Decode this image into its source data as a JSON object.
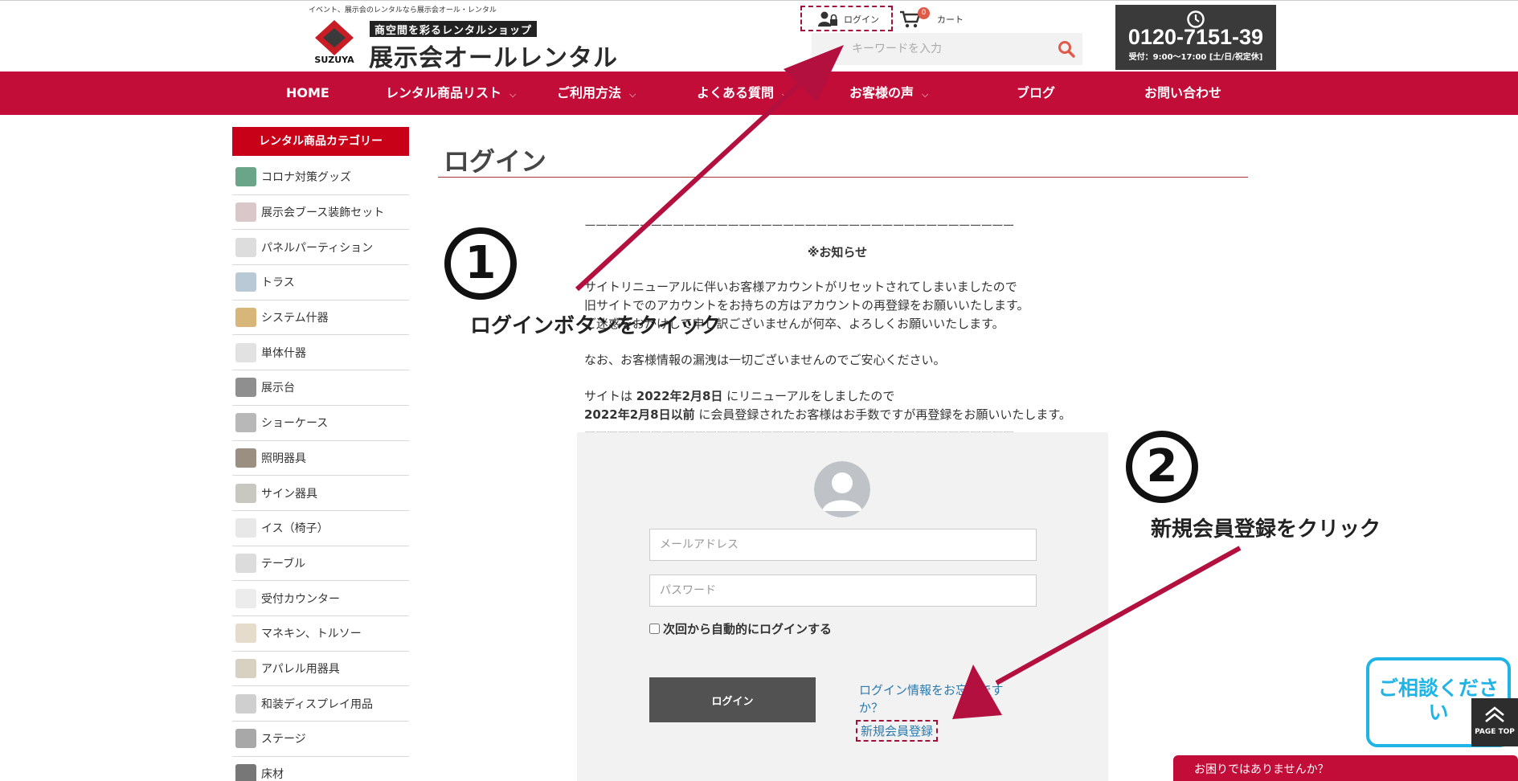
{
  "header": {
    "tagline": "イベント、展示会のレンタルなら展示会オール・レンタル",
    "logo_brand": "SUZUYA",
    "logo_sub": "商空間を彩るレンタルショップ",
    "logo_main": "展示会オールレンタル",
    "login_label": "ログイン",
    "cart_label": "カート",
    "cart_count": "0",
    "search_placeholder": "キーワードを入力",
    "phone_number": "0120-7151-39",
    "phone_hours": "受付：9:00〜17:00 [土/日/祝定休]"
  },
  "nav": [
    {
      "label": "HOME",
      "chevron": ""
    },
    {
      "label": "レンタル商品リスト",
      "chevron": "⌵"
    },
    {
      "label": "ご利用方法",
      "chevron": "⌵"
    },
    {
      "label": "よくある質問",
      "chevron": "⌵"
    },
    {
      "label": "お客様の声",
      "chevron": "⌵"
    },
    {
      "label": "ブログ",
      "chevron": ""
    },
    {
      "label": "お問い合わせ",
      "chevron": ""
    }
  ],
  "sidebar": {
    "title": "レンタル商品カテゴリー",
    "items": [
      {
        "label": "コロナ対策グッズ",
        "color": "#6aa58a"
      },
      {
        "label": "展示会ブース装飾セット",
        "color": "#d9c7c9"
      },
      {
        "label": "パネルパーティション",
        "color": "#dddddd"
      },
      {
        "label": "トラス",
        "color": "#b9c9d6"
      },
      {
        "label": "システム什器",
        "color": "#d8b679"
      },
      {
        "label": "単体什器",
        "color": "#e2e2e2"
      },
      {
        "label": "展示台",
        "color": "#8f8f8f"
      },
      {
        "label": "ショーケース",
        "color": "#b8b8b8"
      },
      {
        "label": "照明器具",
        "color": "#9a8f80"
      },
      {
        "label": "サイン器具",
        "color": "#c8c8c0"
      },
      {
        "label": "イス（椅子）",
        "color": "#e8e8e8"
      },
      {
        "label": "テーブル",
        "color": "#dcdcdc"
      },
      {
        "label": "受付カウンター",
        "color": "#ececec"
      },
      {
        "label": "マネキン、トルソー",
        "color": "#e6dccc"
      },
      {
        "label": "アパレル用器具",
        "color": "#d8d0c0"
      },
      {
        "label": "和装ディスプレイ用品",
        "color": "#cfcfcf"
      },
      {
        "label": "ステージ",
        "color": "#a8a8a8"
      },
      {
        "label": "床材",
        "color": "#777777"
      }
    ]
  },
  "main": {
    "page_title": "ログイン",
    "dashes": "ーーーーーーーーーーーーーーーーーーーーーーーーーーーーーーーーーーーーーーー",
    "notice_title": "※お知らせ",
    "notice_line1": "サイトリニューアルに伴いお客様アカウントがリセットされてしまいましたので",
    "notice_line2": "旧サイトでのアカウントをお持ちの方はアカウントの再登録をお願いいたします。",
    "notice_line3": "ご迷惑をおかけして申し訳ございませんが何卒、よろしくお願いいたします。",
    "notice_line4": "なお、お客様情報の漏洩は一切ございませんのでご安心ください。",
    "notice_line5_prefix": "サイトは ",
    "notice_line5_date": "2022年2月8日",
    "notice_line5_suffix": " にリニューアルをしましたので",
    "notice_line6_date": "2022年2月8日以前",
    "notice_line6_suffix": " に会員登録されたお客様はお手数ですが再登録をお願いいたします。"
  },
  "login_form": {
    "email_placeholder": "メールアドレス",
    "password_placeholder": "パスワード",
    "remember_label": "次回から自動的にログインする",
    "login_button": "ログイン",
    "forgot_link": "ログイン情報をお忘れですか？",
    "register_link": "新規会員登録"
  },
  "annotations": {
    "step1_number": "1",
    "step1_text": "ログインボタンをクイック",
    "step2_number": "2",
    "step2_text": "新規会員登録をクリック"
  },
  "widgets": {
    "consult_text": "ご相談ください",
    "page_top_label": "PAGE TOP",
    "help_bar": "お困りではありませんか？"
  },
  "colors": {
    "nav": "#c20d39",
    "sidebar_title": "#c80018",
    "annotation_arrow": "#b3103f",
    "link": "#2a7ab0",
    "consult_border": "#1fb4e6"
  }
}
